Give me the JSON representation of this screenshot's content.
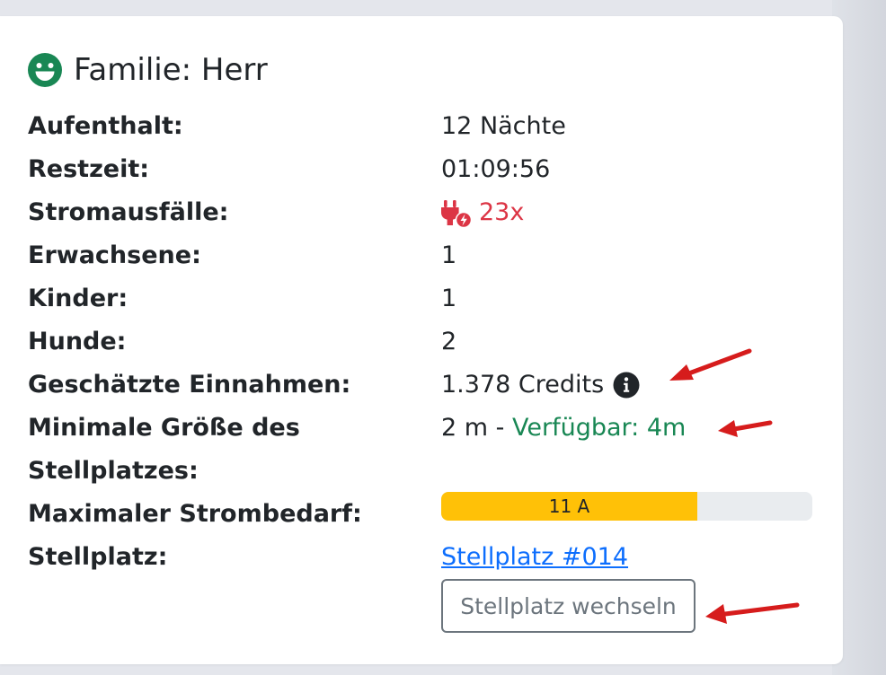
{
  "header": {
    "title": "Familie: Herr",
    "icon": "smile-icon",
    "icon_color": "#198754"
  },
  "rows": {
    "stay": {
      "label": "Aufenthalt:",
      "value": "12 Nächte"
    },
    "remaining": {
      "label": "Restzeit:",
      "value": "01:09:56"
    },
    "outages": {
      "label": "Stromausfälle:",
      "value": "23x",
      "icon": "power-outage-plug-icon",
      "color": "#dc3545"
    },
    "adults": {
      "label": "Erwachsene:",
      "value": "1"
    },
    "children": {
      "label": "Kinder:",
      "value": "1"
    },
    "dogs": {
      "label": "Hunde:",
      "value": "2"
    },
    "income": {
      "label": "Geschätzte Einnahmen:",
      "value": "1.378 Credits",
      "icon": "info-icon"
    },
    "min_size": {
      "label_line1": "Minimale Größe des",
      "label_line2": "Stellplatzes:",
      "value": "2 m - ",
      "available": "Verfügbar: 4m",
      "available_color": "#198754"
    },
    "power": {
      "label": "Maximaler Strombedarf:",
      "bar_text": "11 A",
      "bar_fraction": 0.69,
      "bar_color": "#ffc107"
    },
    "spot": {
      "label": "Stellplatz:",
      "link": "Stellplatz #014",
      "button": "Stellplatz wechseln"
    }
  },
  "annotations": {
    "arrow_color": "#d61c1c"
  }
}
